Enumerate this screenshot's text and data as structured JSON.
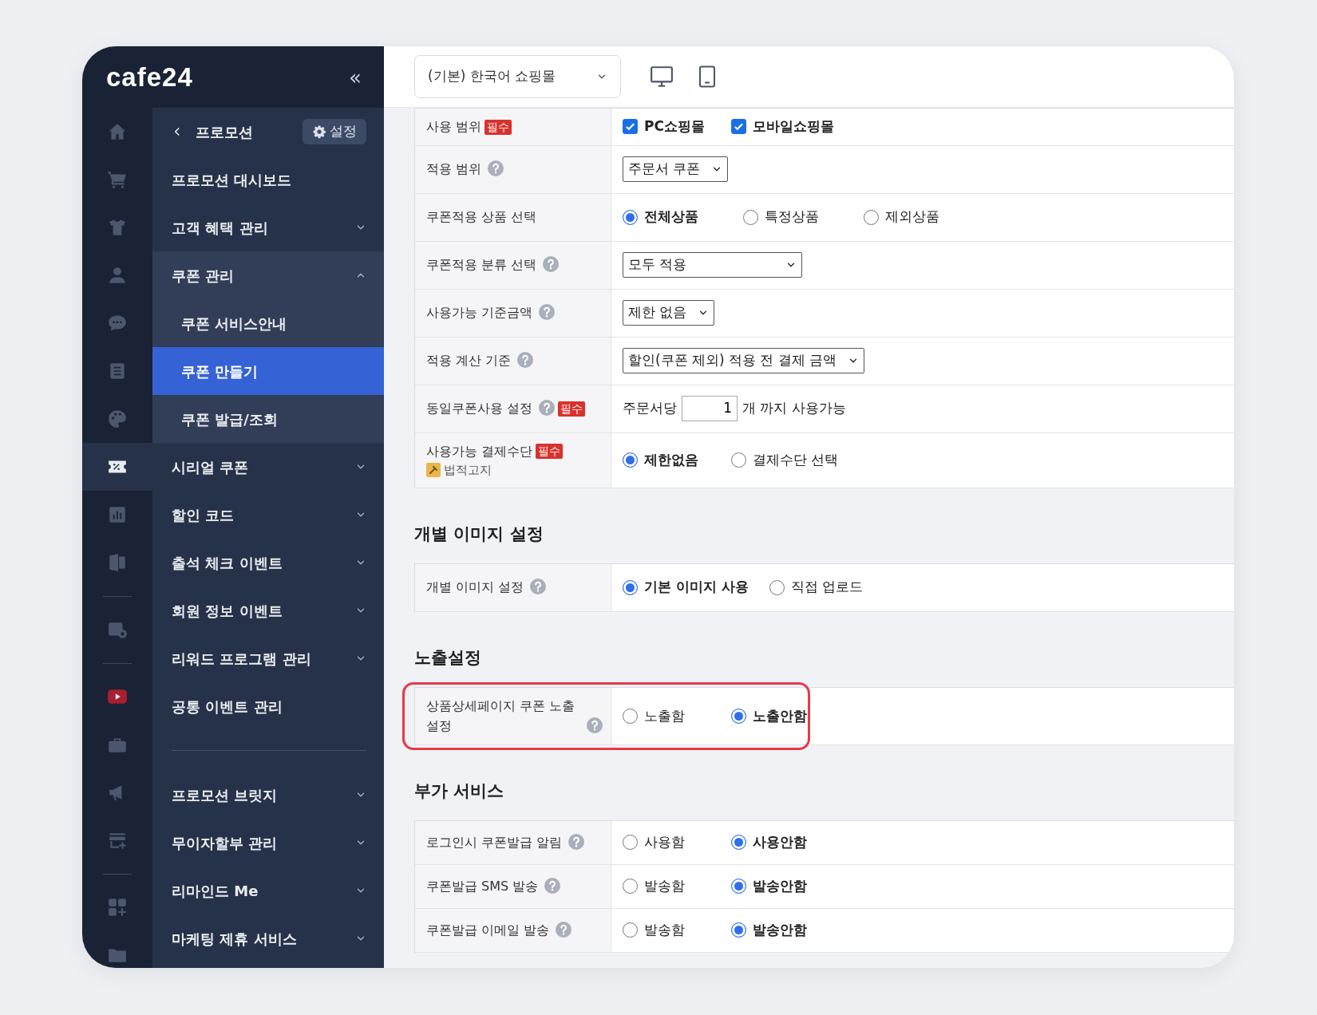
{
  "sidebar": {
    "logo": "cafe24",
    "collapse": "«",
    "rail": [
      {
        "kind": "home",
        "selected": false
      },
      {
        "kind": "cart",
        "selected": false
      },
      {
        "kind": "shirt",
        "selected": false
      },
      {
        "kind": "person",
        "selected": false
      },
      {
        "kind": "chat",
        "selected": false
      },
      {
        "kind": "document",
        "selected": false
      },
      {
        "kind": "palette",
        "selected": false
      },
      {
        "kind": "coupon",
        "selected": true
      },
      {
        "kind": "chart",
        "selected": false
      },
      {
        "kind": "sheet",
        "selected": false
      },
      {
        "kind": "divider"
      },
      {
        "kind": "calendar",
        "selected": false
      },
      {
        "kind": "divider"
      },
      {
        "kind": "video",
        "selected": false
      },
      {
        "kind": "briefcase",
        "selected": false
      },
      {
        "kind": "megaphone",
        "selected": false
      },
      {
        "kind": "store",
        "selected": false
      },
      {
        "kind": "divider"
      },
      {
        "kind": "apps",
        "selected": false
      },
      {
        "kind": "folder",
        "selected": false
      }
    ],
    "menu": {
      "back": "프로모션",
      "settings": "설정",
      "items": [
        {
          "kind": "link",
          "label": "프로모션 대시보드",
          "selected": false
        },
        {
          "kind": "group",
          "label": "고객 혜택 관리",
          "selected": false,
          "expanded": false
        },
        {
          "kind": "group",
          "label": "쿠폰 관리",
          "selected": false,
          "expanded": true,
          "children": [
            {
              "label": "쿠폰 서비스안내",
              "selected": false
            },
            {
              "label": "쿠폰 만들기",
              "selected": true
            },
            {
              "label": "쿠폰 발급/조회",
              "selected": false
            }
          ]
        },
        {
          "kind": "group",
          "label": "시리얼 쿠폰",
          "selected": false,
          "expanded": false
        },
        {
          "kind": "group",
          "label": "할인 코드",
          "selected": false,
          "expanded": false
        },
        {
          "kind": "group",
          "label": "출석 체크 이벤트",
          "selected": false,
          "expanded": false
        },
        {
          "kind": "group",
          "label": "회원 정보 이벤트",
          "selected": false,
          "expanded": false
        },
        {
          "kind": "group",
          "label": "리워드 프로그램 관리",
          "selected": false,
          "expanded": false
        },
        {
          "kind": "link",
          "label": "공통 이벤트 관리",
          "selected": false
        },
        {
          "kind": "divider"
        },
        {
          "kind": "group",
          "label": "프로모션 브릿지",
          "selected": false,
          "expanded": false
        },
        {
          "kind": "group",
          "label": "무이자할부 관리",
          "selected": false,
          "expanded": false
        },
        {
          "kind": "group",
          "label": "리마인드 Me",
          "selected": false,
          "expanded": false
        },
        {
          "kind": "group",
          "label": "마케팅 제휴 서비스",
          "selected": false,
          "expanded": false
        }
      ]
    }
  },
  "header": {
    "shop_select": "(기본) 한국어 쇼핑몰"
  },
  "sections": [
    {
      "highlighted": false,
      "rows": [
        {
          "label": "사용 범위",
          "badge": "필수",
          "help": false,
          "kind": "checks",
          "options": [
            {
              "label": "PC쇼핑몰",
              "checked": true
            },
            {
              "label": "모바일쇼핑몰",
              "checked": true
            }
          ]
        },
        {
          "label": "적용 범위",
          "help": true,
          "kind": "select",
          "value": "주문서 쿠폰"
        },
        {
          "label": "쿠폰적용 상품 선택",
          "help": false,
          "kind": "radio",
          "options": [
            {
              "label": "전체상품",
              "selected": true
            },
            {
              "label": "특정상품",
              "selected": false
            },
            {
              "label": "제외상품",
              "selected": false
            }
          ]
        },
        {
          "label": "쿠폰적용 분류 선택",
          "help": true,
          "kind": "select",
          "value": "모두 적용"
        },
        {
          "label": "사용가능 기준금액",
          "help": true,
          "kind": "select",
          "value": "제한 없음"
        },
        {
          "label": "적용 계산 기준",
          "help": true,
          "kind": "select",
          "value": "할인(쿠폰 제외) 적용 전 결제 금액"
        },
        {
          "label": "동일쿠폰사용 설정",
          "help": true,
          "badge": "필수",
          "kind": "count",
          "prefix": "주문서당",
          "value": "1",
          "suffix": "개 까지 사용가능"
        },
        {
          "label": "사용가능 결제수단",
          "help": false,
          "badge": "필수",
          "note": "법적고지",
          "kind": "radio",
          "options": [
            {
              "label": "제한없음",
              "selected": true
            },
            {
              "label": "결제수단 선택",
              "selected": false
            }
          ]
        }
      ]
    },
    {
      "title": "개별 이미지 설정",
      "highlighted": false,
      "rows": [
        {
          "label": "개별 이미지 설정",
          "help": true,
          "kind": "radio",
          "options": [
            {
              "label": "기본 이미지 사용",
              "selected": true
            },
            {
              "label": "직접 업로드",
              "selected": false
            }
          ]
        }
      ]
    },
    {
      "title": "노출설정",
      "highlighted": true,
      "rows": [
        {
          "label": "상품상세페이지 쿠폰 노출 설정",
          "help": true,
          "kind": "radio",
          "options": [
            {
              "label": "노출함",
              "selected": false
            },
            {
              "label": "노출안함",
              "selected": true
            }
          ]
        }
      ]
    },
    {
      "title": "부가 서비스",
      "highlighted": false,
      "rows": [
        {
          "label": "로그인시 쿠폰발급 알림",
          "help": true,
          "kind": "radio",
          "options": [
            {
              "label": "사용함",
              "selected": false
            },
            {
              "label": "사용안함",
              "selected": true
            }
          ]
        },
        {
          "label": "쿠폰발급 SMS 발송",
          "help": true,
          "kind": "radio",
          "options": [
            {
              "label": "발송함",
              "selected": false
            },
            {
              "label": "발송안함",
              "selected": true
            }
          ]
        },
        {
          "label": "쿠폰발급 이메일 발송",
          "help": true,
          "kind": "radio",
          "options": [
            {
              "label": "발송함",
              "selected": false
            },
            {
              "label": "발송안함",
              "selected": true
            }
          ]
        }
      ]
    }
  ]
}
